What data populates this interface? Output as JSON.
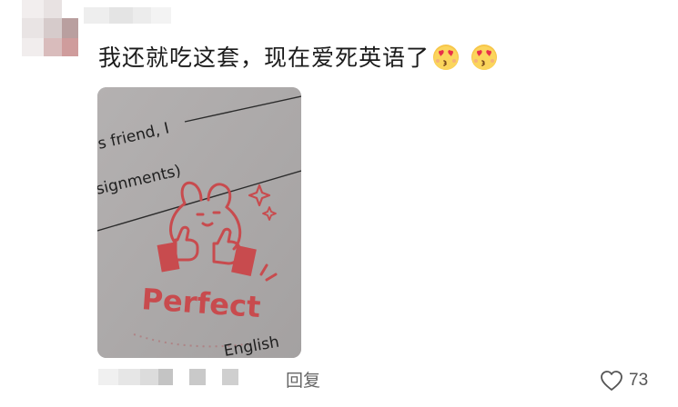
{
  "comment": {
    "text": "我还就吃这套，现在爱死英语了",
    "emojis": [
      "heart-eyes-kiss-emoji",
      "heart-eyes-kiss-emoji"
    ]
  },
  "photo": {
    "line1_text": "s friend, I",
    "line2_text": "signments)",
    "stamp_text": "Perfect",
    "bottom_text": "English"
  },
  "actions": {
    "reply_label": "回复",
    "like_count": "73"
  },
  "colors": {
    "stamp_red": "#c84b4e",
    "text_gray": "#666666",
    "paper": "#aeabab"
  }
}
